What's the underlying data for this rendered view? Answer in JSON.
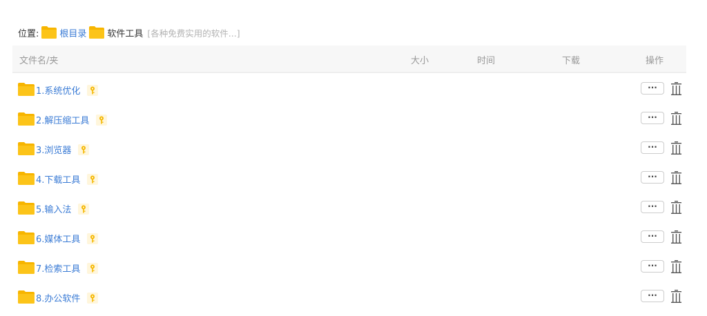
{
  "breadcrumb": {
    "label": "位置:",
    "root": "根目录",
    "current": "软件工具",
    "description": "[各种免费实用的软件...]"
  },
  "table": {
    "columns": {
      "name": "文件名/夹",
      "size": "大小",
      "time": "时间",
      "download": "下载",
      "actions": "操作"
    },
    "rows": [
      {
        "name": "1.系统优化"
      },
      {
        "name": "2.解压缩工具"
      },
      {
        "name": "3.浏览器"
      },
      {
        "name": "4.下载工具"
      },
      {
        "name": "5.输入法"
      },
      {
        "name": "6.媒体工具"
      },
      {
        "name": "7.检索工具"
      },
      {
        "name": "8.办公软件"
      }
    ],
    "more_label": "···"
  },
  "icons": {
    "folder": "folder-icon",
    "key": "key-icon",
    "trash": "trash-icon"
  },
  "colors": {
    "folder": "#f7b500",
    "link": "#3a7bd5",
    "key": "#f5b700",
    "header_bg": "#f7f7f7"
  }
}
